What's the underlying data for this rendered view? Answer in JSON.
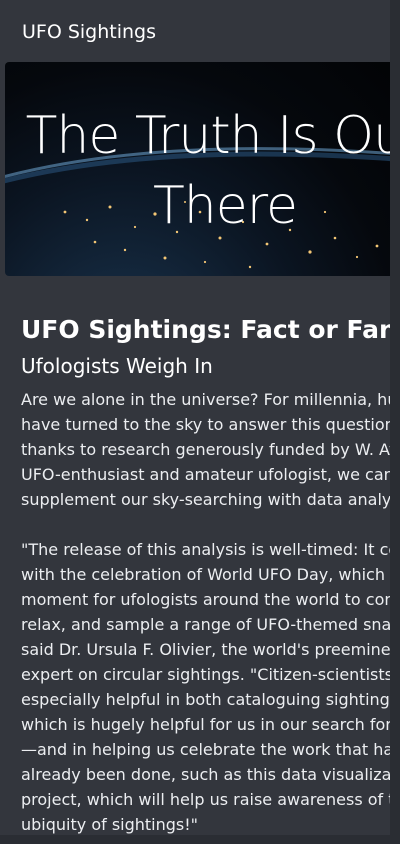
{
  "app": {
    "title": "UFO Sightings"
  },
  "hero": {
    "line1": "The Truth Is Out",
    "line2": "There"
  },
  "article": {
    "heading": "UFO Sightings: Fact or Fancy",
    "subheading": "Ufologists Weigh In",
    "paragraph1": [
      "Are we alone in the universe? For millennia, human",
      "have turned to the sky to answer this question. No",
      "thanks to research generously funded by W. Avy, a",
      "UFO-enthusiast and amateur ufologist, we can",
      "supplement our sky-searching with data analysis."
    ],
    "paragraph2": [
      "\"The release of this analysis is well-timed: It coincid",
      "with the celebration of World UFO Day, which is a",
      "moment for ufologists around the world to connect",
      "relax, and sample a range of UFO-themed snacks,\"",
      "said Dr. Ursula F. Olivier, the world's preeminent",
      "expert on circular sightings. \"Citizen-scientists can",
      "especially helpful in both cataloguing sightings—",
      "which is hugely helpful for us in our search for alie",
      "—and in helping us celebrate the work that has",
      "already been done, such as this data visualization",
      "project, which will help us raise awareness of the",
      "ubiquity of sightings!\""
    ]
  }
}
